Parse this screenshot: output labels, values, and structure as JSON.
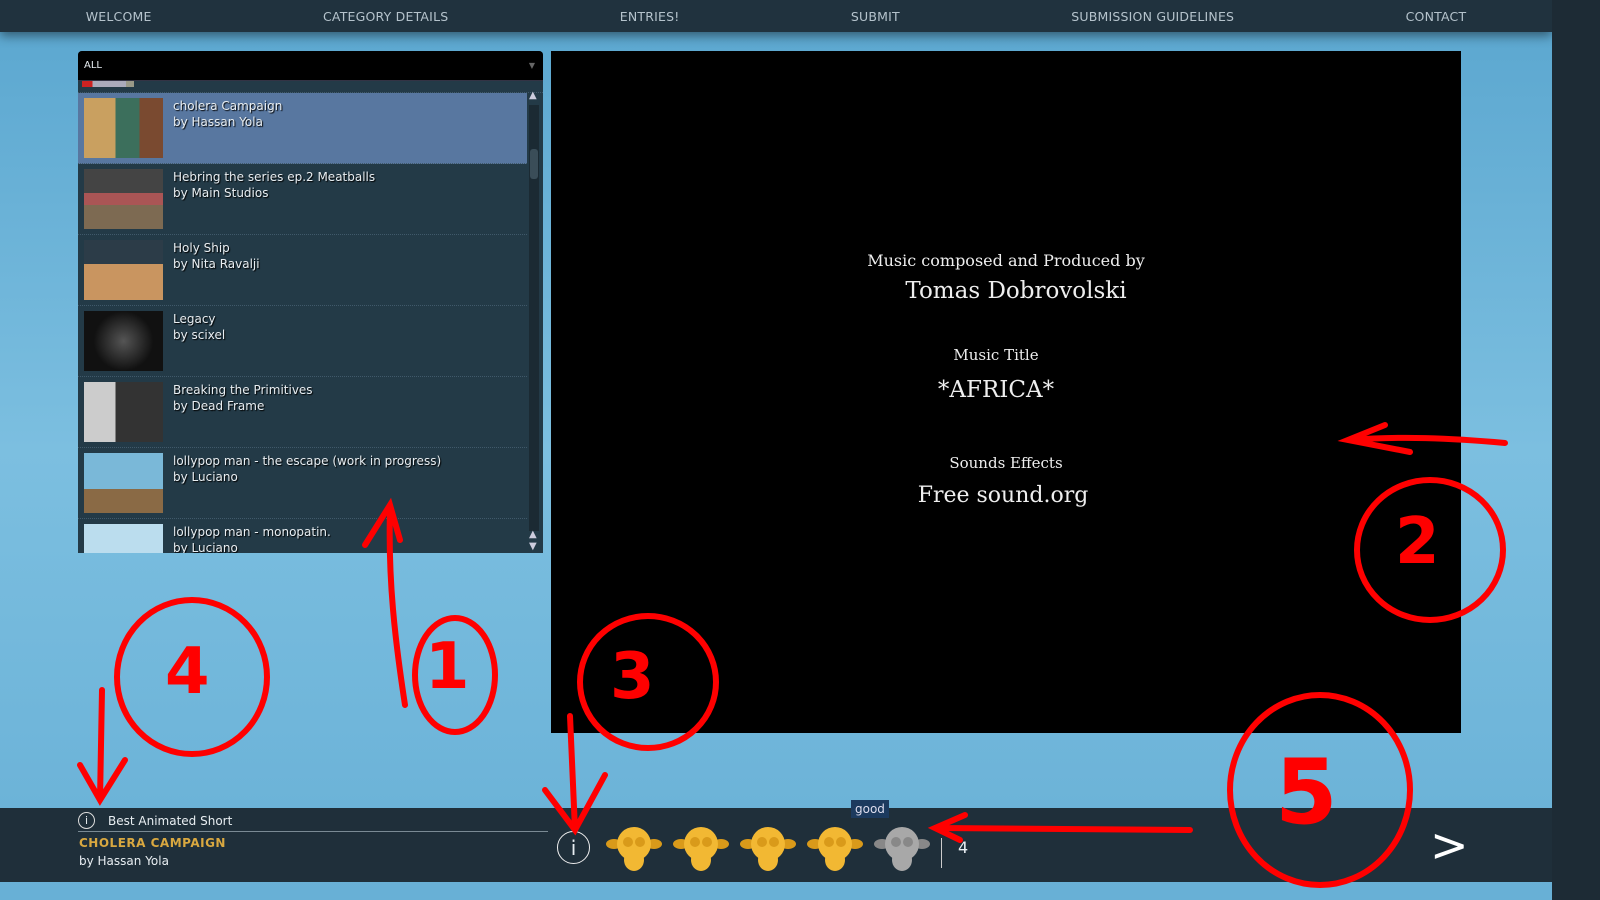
{
  "nav": [
    "WELCOME",
    "CATEGORY DETAILS",
    "ENTRIES!",
    "SUBMIT",
    "SUBMISSION GUIDELINES",
    "CONTACT"
  ],
  "filter": {
    "selected": "ALL"
  },
  "entries": [
    {
      "title": "cholera Campaign",
      "by": "by Hassan Yola"
    },
    {
      "title": "Hebring the series ep.2 Meatballs",
      "by": "by Main Studios"
    },
    {
      "title": "Holy Ship",
      "by": "by Nita Ravalji"
    },
    {
      "title": "Legacy",
      "by": "by scixel"
    },
    {
      "title": "Breaking the Primitives",
      "by": "by Dead Frame"
    },
    {
      "title": "lollypop man - the escape (work in progress)",
      "by": "by Luciano"
    },
    {
      "title": "lollypop man - monopatin.",
      "by": "by Luciano"
    }
  ],
  "video": {
    "l1": "Music composed and Produced by",
    "l2": "Tomas Dobrovolski",
    "l3": "Music Title",
    "l4": "*AFRICA*",
    "l5": "Sounds Effects",
    "l6": "Free sound.org"
  },
  "bottom": {
    "category": "Best Animated Short",
    "title": "CHOLERA CAMPAIGN",
    "by": "by Hassan Yola",
    "tooltip": "good",
    "rating": 4,
    "rating_max": 5,
    "count": "4",
    "next": ">"
  },
  "annotations": [
    "1",
    "2",
    "3",
    "4",
    "5"
  ],
  "colors": {
    "accent": "#d9a840",
    "selected": "#5877a0",
    "annotation": "#ff0000"
  }
}
